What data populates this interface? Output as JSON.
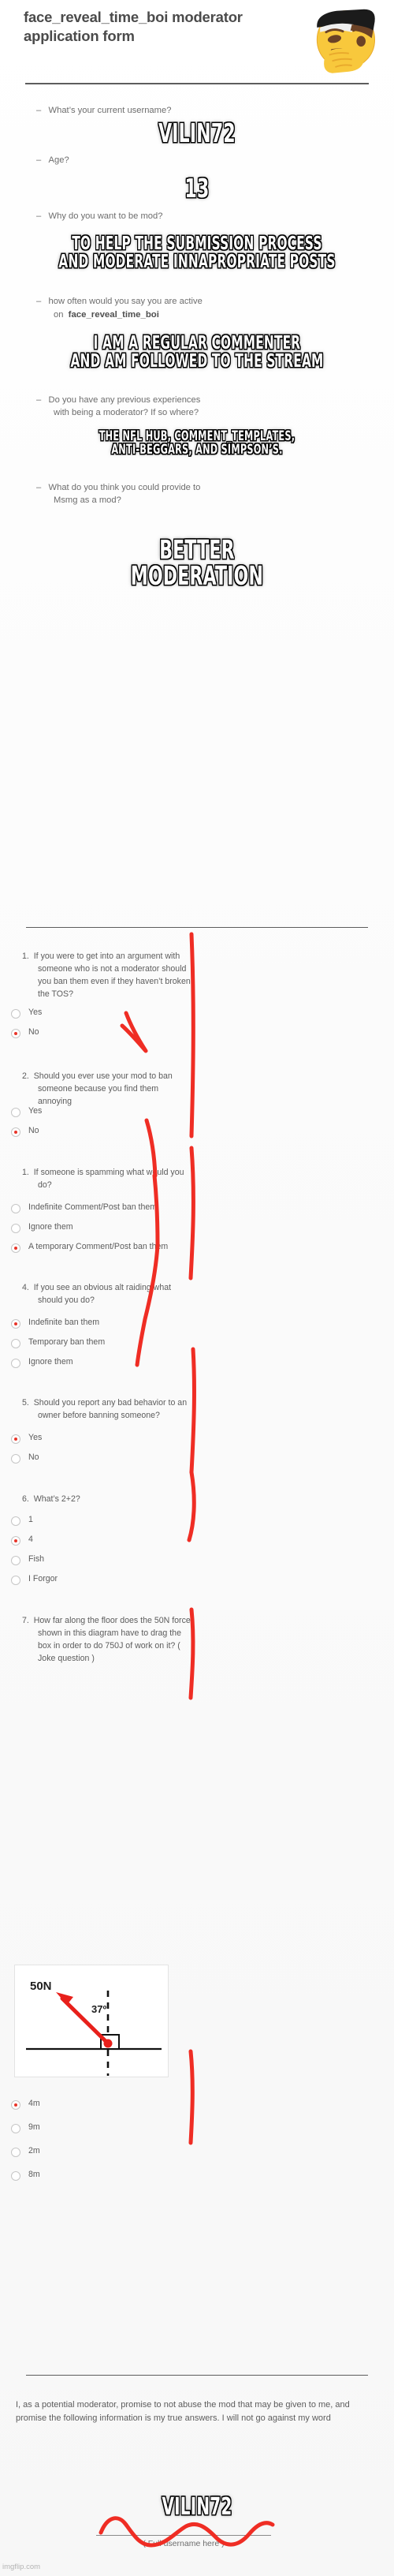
{
  "header": {
    "title_line1": "face_reveal_time_boi  moderator",
    "title_line2": "application form",
    "emoji": "thinking-face-emoji"
  },
  "bullet_questions": [
    {
      "q": "What’s your current username?",
      "answer": [
        "VILIN72"
      ]
    },
    {
      "q": "Age?",
      "answer": [
        "13"
      ]
    },
    {
      "q": "Why do you want to be mod?",
      "answer": [
        "TO HELP THE SUBMISSION PROCESS",
        "AND MODERATE INNAPROPRIATE POSTS"
      ]
    },
    {
      "q": "how often would you say you are active",
      "q2": "on",
      "q2_bold": "face_reveal_time_boi",
      "answer": [
        "I AM A REGULAR COMMENTER",
        "AND AM FOLLOWED TO THE STREAM"
      ]
    },
    {
      "q": "Do you have any previous experiences",
      "q2": "with being a moderator? If so where?",
      "answer": [
        "THE NFL HUB, COMMENT_TEMPLATES,",
        "ANTI-BEGGARS, AND SIMPSON’S."
      ]
    },
    {
      "q": "What do you think you could provide to",
      "q2": "Msmg as a mod?",
      "answer": [
        "BETTER",
        "MODERATION"
      ]
    }
  ],
  "quiz": [
    {
      "num": "1.",
      "text": "If you were to get into an argument with someone who is not a moderator should you ban them even if they haven’t broken the TOS?",
      "options": [
        {
          "label": "Yes",
          "selected": false
        },
        {
          "label": "No",
          "selected": true
        }
      ]
    },
    {
      "num": "2.",
      "text": "Should you ever use your mod to ban someone because you find them annoying",
      "options": [
        {
          "label": "Yes",
          "selected": false
        },
        {
          "label": "No",
          "selected": true
        }
      ]
    },
    {
      "num": "1.",
      "text": "If someone is spamming what would you do?",
      "options": [
        {
          "label": "Indefinite Comment/Post ban them",
          "selected": false
        },
        {
          "label": "Ignore them",
          "selected": false
        },
        {
          "label": "A temporary Comment/Post ban them",
          "selected": true
        }
      ]
    },
    {
      "num": "4.",
      "text": "If you see an obvious alt raiding what should you do?",
      "options": [
        {
          "label": "Indefinite ban them",
          "selected": true
        },
        {
          "label": "Temporary ban them",
          "selected": false
        },
        {
          "label": "Ignore them",
          "selected": false
        }
      ]
    },
    {
      "num": "5.",
      "text": "Should you report any bad behavior to an owner before banning someone?",
      "options": [
        {
          "label": "Yes",
          "selected": true
        },
        {
          "label": "No",
          "selected": false
        }
      ]
    },
    {
      "num": "6.",
      "text": "What’s 2+2?",
      "options": [
        {
          "label": "1",
          "selected": false
        },
        {
          "label": "4",
          "selected": true
        },
        {
          "label": "Fish",
          "selected": false
        },
        {
          "label": "I Forgor",
          "selected": false
        }
      ]
    },
    {
      "num": "7.",
      "text": "How far along the floor does the 50N force shown in this diagram have to drag the box in order to do 750J of work on it? ( Joke question )",
      "options": [
        {
          "label": "4m",
          "selected": true
        },
        {
          "label": "9m",
          "selected": false
        },
        {
          "label": "2m",
          "selected": false
        },
        {
          "label": "8m",
          "selected": false
        }
      ]
    }
  ],
  "diagram": {
    "force_label": "50N",
    "angle_label": "37º",
    "arrow_color": "#e8201b"
  },
  "promise": {
    "text": "I, as a potential moderator, promise to not abuse the mod that may be given to me, and promise the following information is my true answers. I will not go against my word",
    "signature": "VILIN72",
    "signature_hint": "( Full username here )"
  },
  "watermark": "imgflip.com",
  "colors": {
    "radio_selected": "#e8352a",
    "annotation_red": "#ef2d24",
    "text_gray": "#5c5c5c",
    "heading_gray": "#4b4b4b"
  }
}
